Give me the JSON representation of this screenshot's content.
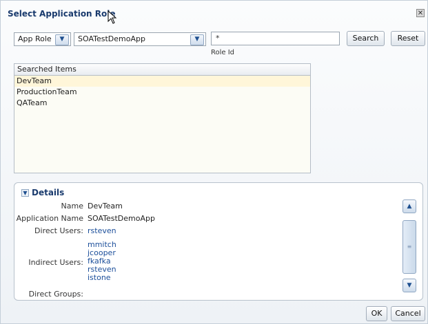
{
  "dialog": {
    "title": "Select Application Role",
    "close_glyph": "✕"
  },
  "search": {
    "type_selected": "App Role",
    "app_selected": "SOATestDemoApp",
    "query_value": "*",
    "query_field_label": "Role Id",
    "search_label": "Search",
    "reset_label": "Reset"
  },
  "results": {
    "header": "Searched Items",
    "items": [
      "DevTeam",
      "ProductionTeam",
      "QATeam"
    ],
    "selected_index": 0
  },
  "details": {
    "header": "Details",
    "name_label": "Name",
    "name_value": "DevTeam",
    "app_name_label": "Application Name",
    "app_name_value": "SOATestDemoApp",
    "direct_users_label": "Direct Users:",
    "direct_users": [
      "rsteven"
    ],
    "indirect_users_label": "Indirect Users:",
    "indirect_users": [
      "mmitch",
      "jcooper",
      "fkafka",
      "rsteven",
      "istone"
    ],
    "direct_groups_label": "Direct Groups:"
  },
  "footer": {
    "ok_label": "OK",
    "cancel_label": "Cancel"
  },
  "icons": {
    "dropdown": "chevron-down-icon",
    "collapse": "collapse-icon",
    "scroll_up": "chevron-up-icon",
    "scroll_down": "chevron-down-icon"
  }
}
